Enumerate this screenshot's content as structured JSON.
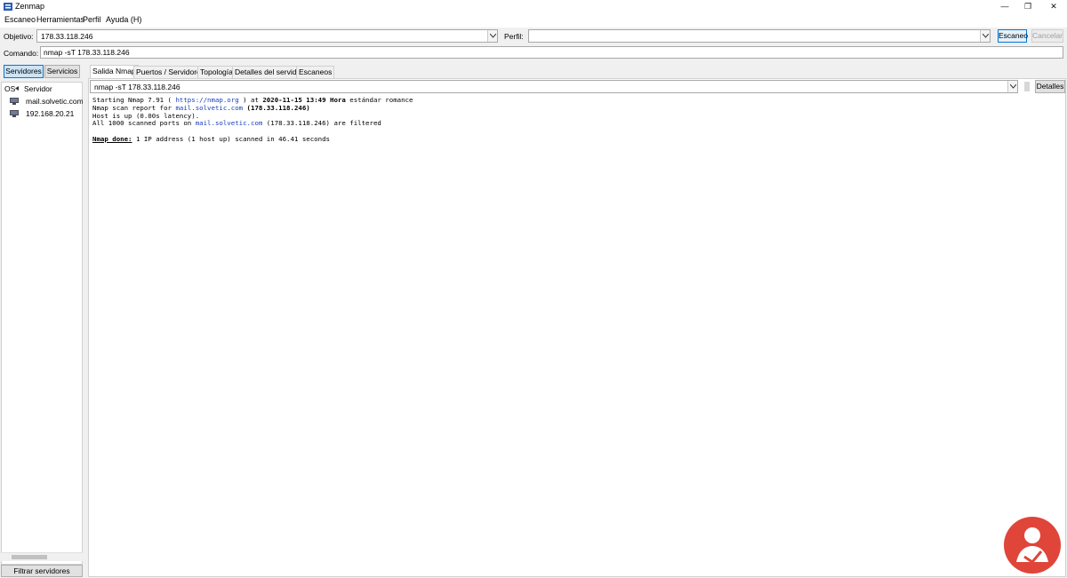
{
  "window": {
    "title": "Zenmap",
    "controls": {
      "minimize": "—",
      "restore": "❐",
      "close": "✕"
    }
  },
  "menu": {
    "items": [
      "Escaneo",
      "Herramientas",
      "Perfil",
      "Ayuda (H)"
    ]
  },
  "toolbar": {
    "target_label": "Objetivo:",
    "target_value": "178.33.118.246",
    "profile_label": "Perfil:",
    "profile_value": "",
    "scan_button": "Escaneo",
    "cancel_button": "Cancelar",
    "command_label": "Comando:",
    "command_value": "nmap -sT 178.33.118.246"
  },
  "left": {
    "toggle_hosts": "Servidores",
    "toggle_services": "Servicios",
    "header_os": "OS",
    "header_host": "Servidor",
    "hosts": [
      "mail.solvetic.com (",
      "192.168.20.21"
    ],
    "filter_button": "Filtrar servidores"
  },
  "tabs": [
    "Salida Nmap",
    "Puertos / Servidores",
    "Topología",
    "Detalles del servidor",
    "Escaneos"
  ],
  "output": {
    "selector_value": "nmap -sT 178.33.118.246",
    "details_button": "Detalles",
    "lines": {
      "l1_pre": "Starting Nmap 7.91 ( ",
      "l1_link": "https://nmap.org",
      "l1_mid": " ) at ",
      "l1_bold": "2020-11-15 13:49 Hora",
      "l1_post": " estándar romance",
      "l2_pre": "Nmap scan report for ",
      "l2_link": "mail.solvetic.com",
      "l2_post": " (178.33.118.246)",
      "l3": "Host is up (0.00s latency).",
      "l4_pre": "All 1000 scanned ports on ",
      "l4_link": "mail.solvetic.com",
      "l4_post": " (178.33.118.246) are filtered",
      "l6_ul": "Nmap done:",
      "l6_post": " 1 IP address (1 host up) scanned in 46.41 seconds"
    }
  },
  "colors": {
    "accent": "#0078d7",
    "link": "#1a3fbd",
    "logo_red": "#e0453a"
  }
}
